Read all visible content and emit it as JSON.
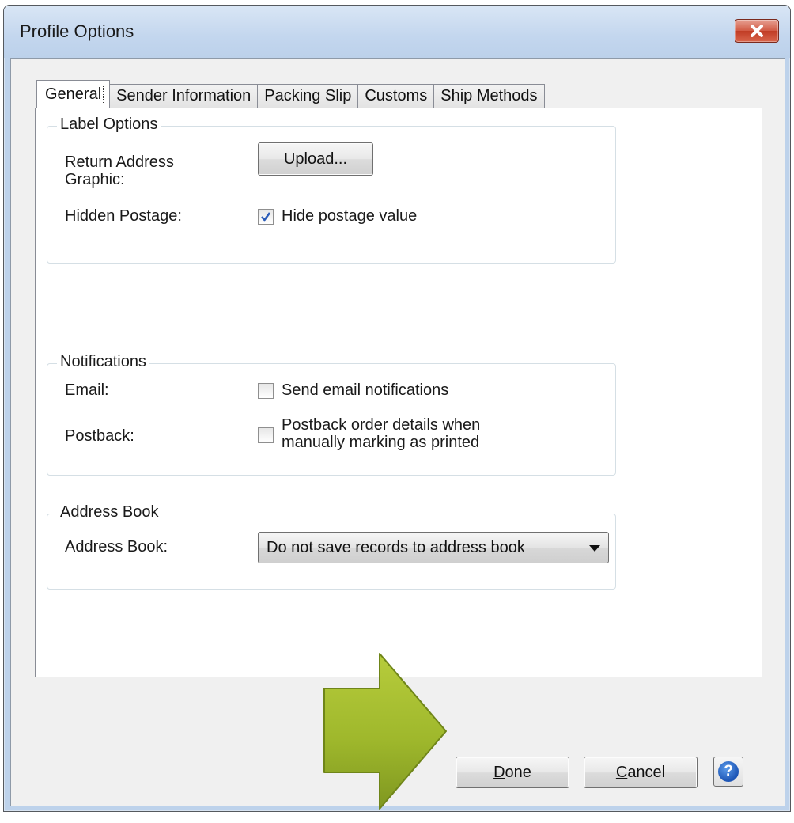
{
  "window": {
    "title": "Profile Options"
  },
  "tabs": [
    {
      "label": "General",
      "active": true
    },
    {
      "label": "Sender Information"
    },
    {
      "label": "Packing Slip"
    },
    {
      "label": "Customs"
    },
    {
      "label": "Ship Methods"
    }
  ],
  "label_options": {
    "title": "Label Options",
    "return_address_label_line1": "Return Address",
    "return_address_label_line2": "Graphic:",
    "upload_button": "Upload...",
    "hidden_postage_label": "Hidden Postage:",
    "hide_postage_checkbox": "Hide postage value",
    "hide_postage_checked": true
  },
  "notifications": {
    "title": "Notifications",
    "email_label": "Email:",
    "email_checkbox": "Send email notifications",
    "email_checked": false,
    "postback_label": "Postback:",
    "postback_checkbox_line1": "Postback order details when",
    "postback_checkbox_line2": "manually marking as printed",
    "postback_checked": false
  },
  "address_book": {
    "title": "Address Book",
    "label": "Address Book:",
    "selected": "Do not save records to address book"
  },
  "footer": {
    "done_mnemonic": "D",
    "done_rest": "one",
    "cancel_mnemonic": "C",
    "cancel_rest": "ancel",
    "help_glyph": "?"
  },
  "colors": {
    "accent_arrow": "#9fb82c",
    "help_blue": "#1d55b5",
    "close_red": "#c03b24"
  }
}
